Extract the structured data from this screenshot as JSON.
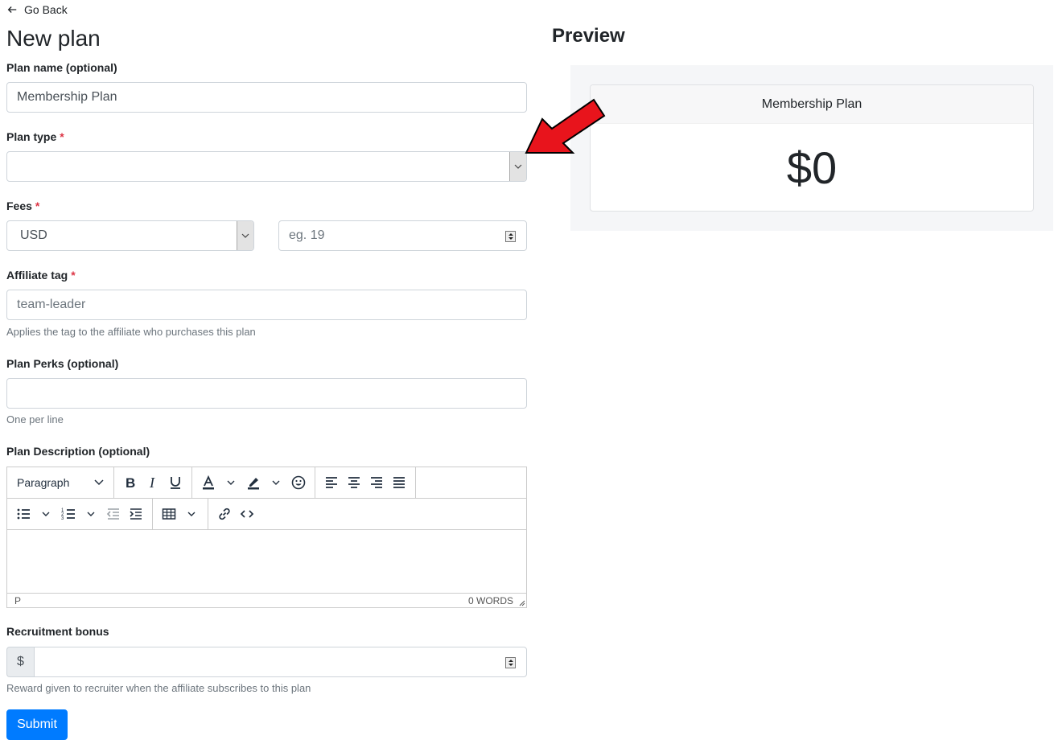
{
  "nav": {
    "back_label": "Go Back"
  },
  "page": {
    "title": "New plan",
    "preview_title": "Preview"
  },
  "form": {
    "plan_name": {
      "label": "Plan name (optional)",
      "value": "Membership Plan"
    },
    "plan_type": {
      "label": "Plan type",
      "required_mark": "*",
      "value": ""
    },
    "fees": {
      "label": "Fees",
      "required_mark": "*",
      "currency": "USD",
      "amount_placeholder": "eg. 19"
    },
    "affiliate_tag": {
      "label": "Affiliate tag",
      "required_mark": "*",
      "placeholder": "team-leader",
      "help": "Applies the tag to the affiliate who purchases this plan"
    },
    "plan_perks": {
      "label": "Plan Perks (optional)",
      "value": "",
      "help": "One per line"
    },
    "plan_description": {
      "label": "Plan Description (optional)",
      "block_format": "Paragraph",
      "status_path": "P",
      "word_count": "0 WORDS",
      "toolbar_icons": [
        "bold-icon",
        "italic-icon",
        "underline-icon",
        "text-color-icon",
        "highlight-icon",
        "emoji-icon",
        "align-left-icon",
        "align-center-icon",
        "align-right-icon",
        "align-justify-icon",
        "bullet-list-icon",
        "numbered-list-icon",
        "outdent-icon",
        "indent-icon",
        "table-icon",
        "link-icon",
        "code-icon"
      ]
    },
    "recruitment_bonus": {
      "label": "Recruitment bonus",
      "prefix": "$",
      "value": "",
      "help": "Reward given to recruiter when the affiliate subscribes to this plan"
    },
    "submit_label": "Submit"
  },
  "preview": {
    "plan_name": "Membership Plan",
    "price": "$0"
  },
  "colors": {
    "primary": "#007bff",
    "required": "#dc3545",
    "annotation_arrow": "#e8141c"
  }
}
